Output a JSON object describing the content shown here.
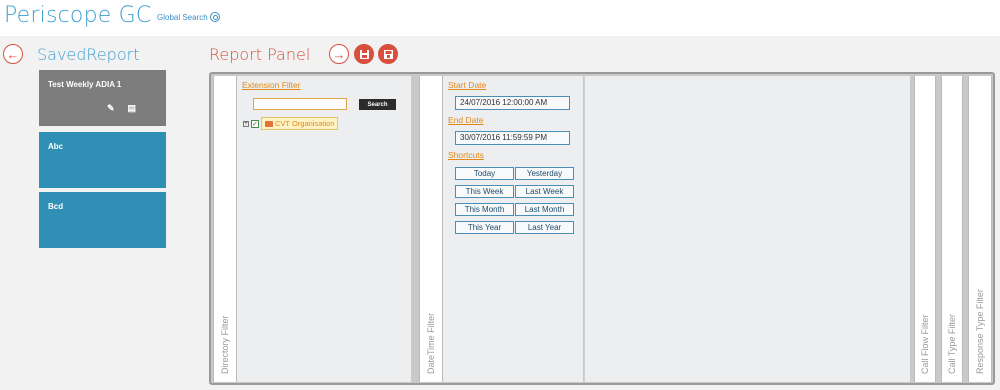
{
  "app": {
    "title": "Periscope GC",
    "global_search": "Global Search"
  },
  "saved_report": {
    "title": "SavedReport",
    "items": [
      {
        "label": "Test Weekly ADIA 1"
      },
      {
        "label": "Abc"
      },
      {
        "label": "Bcd"
      }
    ]
  },
  "report_panel": {
    "title": "Report Panel"
  },
  "tabs": {
    "directory": "Directory Filter",
    "datetime": "DateTime Filter",
    "callflow": "Call Flow Filter",
    "calltype": "Call Type Filter",
    "response": "Response Type Filter"
  },
  "directory_filter": {
    "extension_filter": "Extension Filter",
    "search_value": "",
    "search_label": "Search",
    "tree_toggle": "+",
    "tree_check": "✓",
    "tree_node": "CVT Organisation"
  },
  "datetime_filter": {
    "start_label": "Start Date",
    "start_value": "24/07/2016 12:00:00 AM",
    "end_label": "End Date",
    "end_value": "30/07/2016 11:59:59 PM",
    "shortcuts_label": "Shortcuts",
    "shortcuts": [
      "Today",
      "Yesterday",
      "This Week",
      "Last Week",
      "This Month",
      "Last Month",
      "This Year",
      "Last Year"
    ]
  },
  "colors": {
    "brand_blue": "#3d9fd0",
    "accent_red": "#d94f3d",
    "card_grey": "#7d7d7d",
    "card_blue": "#2f8fb5",
    "link_orange": "#e08a1e"
  }
}
